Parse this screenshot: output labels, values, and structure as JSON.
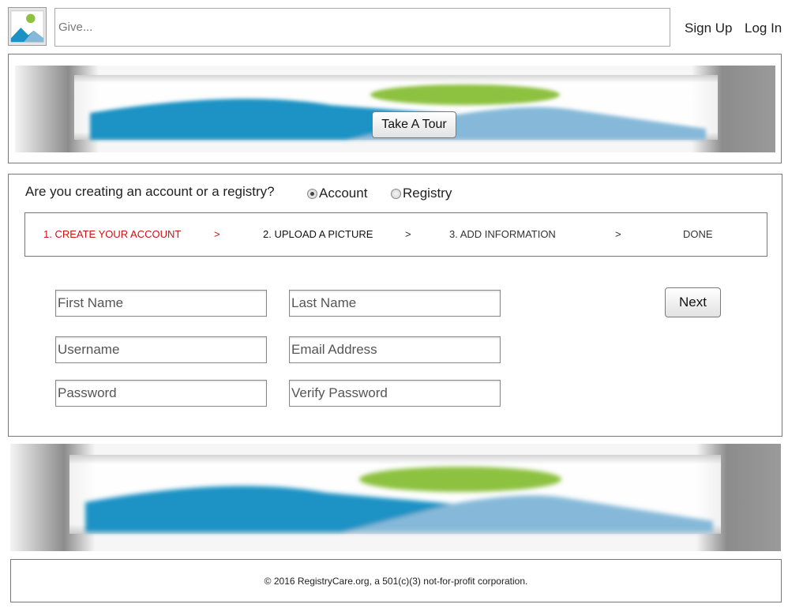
{
  "header": {
    "logo_icon": "image-placeholder-icon",
    "search_placeholder": "Give...",
    "signup_label": "Sign Up",
    "login_label": "Log In"
  },
  "hero": {
    "tour_button_label": "Take A Tour"
  },
  "signup_form": {
    "question": "Are you creating an account or a registry?",
    "options": [
      {
        "label": "Account",
        "selected": true
      },
      {
        "label": "Registry",
        "selected": false
      }
    ],
    "steps": [
      {
        "label": "1. CREATE YOUR ACCOUNT",
        "active": true
      },
      {
        "label": "2. UPLOAD A PICTURE",
        "active": false
      },
      {
        "label": "3. ADD INFORMATION",
        "active": false
      },
      {
        "label": "DONE",
        "active": false
      }
    ],
    "step_separator": ">",
    "fields": {
      "first_name": "First Name",
      "last_name": "Last Name",
      "username": "Username",
      "email": "Email Address",
      "password": "Password",
      "verify_password": "Verify Password"
    },
    "next_label": "Next"
  },
  "footer": {
    "text": "© 2016 RegistryCare.org, a 501(c)(3) not-for-profit corporation."
  },
  "colors": {
    "active_step": "#cc1111",
    "banner_blue_dark": "#1a93c4",
    "banner_blue_light": "#86b9d9",
    "banner_green": "#8dc13f"
  }
}
